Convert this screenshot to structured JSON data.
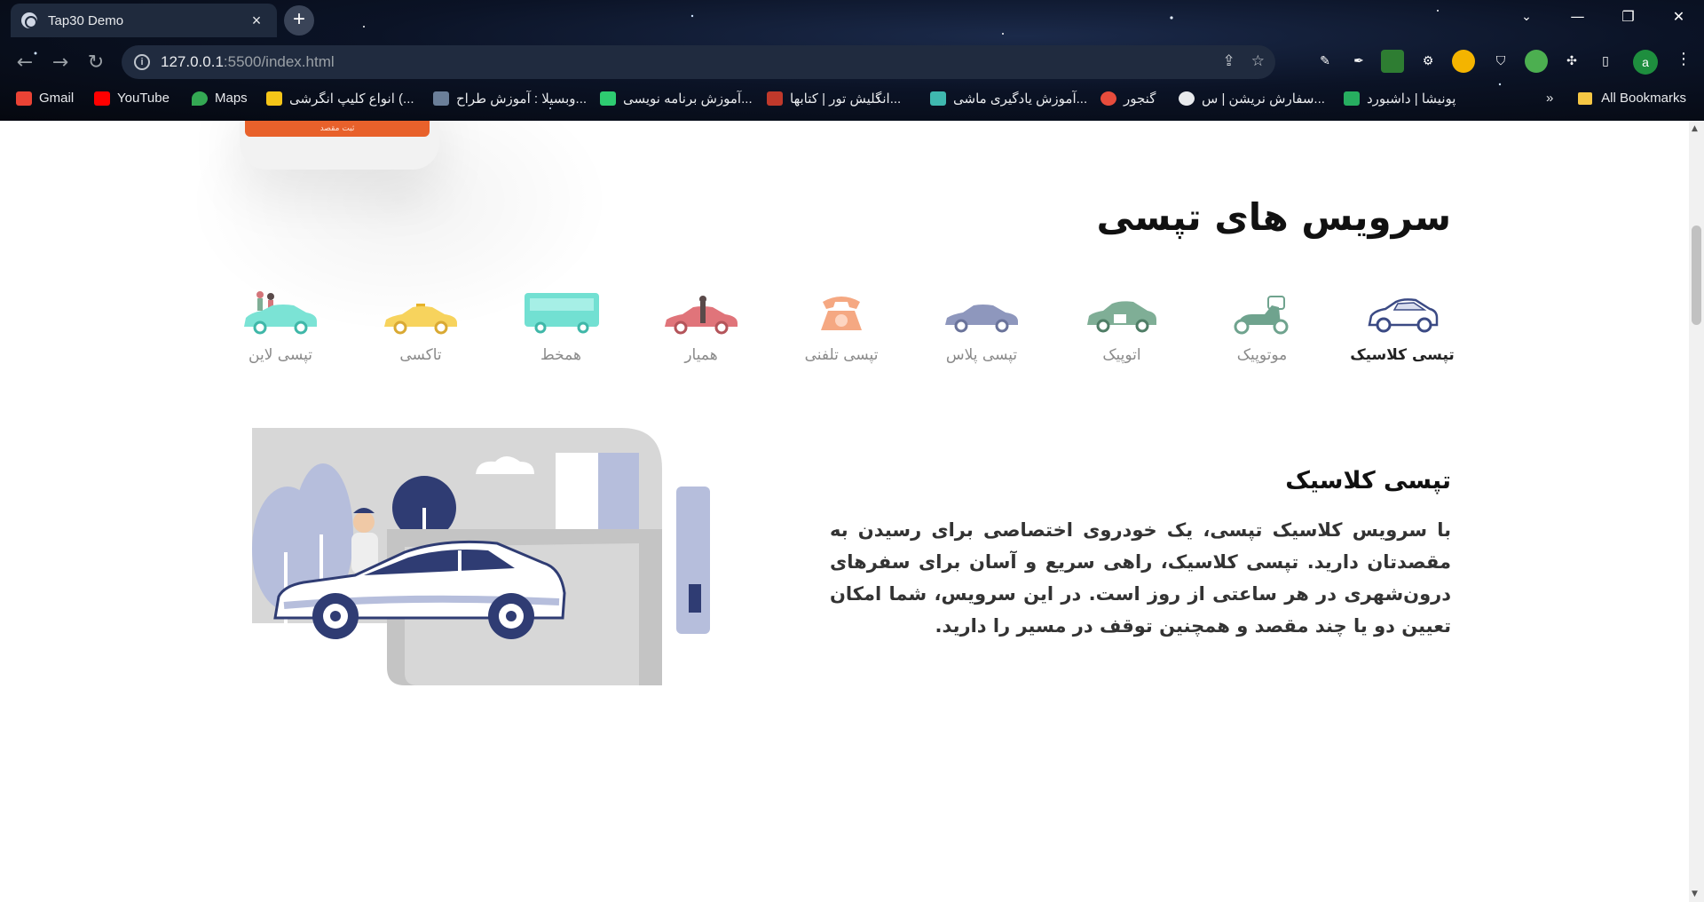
{
  "browser": {
    "tab_title": "Tap30 Demo",
    "tab_close": "×",
    "new_tab": "+",
    "url_host": "127.0.0.1",
    "url_path": ":5500/index.html",
    "profile_initial": "a",
    "bookmarks": [
      {
        "label": "Gmail",
        "color": "#ea4335"
      },
      {
        "label": "YouTube",
        "color": "#ff0000"
      },
      {
        "label": "Maps",
        "color": "#34a853"
      },
      {
        "label": "انواع کلیپ انگرشی (...",
        "color": "#f5c518"
      },
      {
        "label": "وبسیلا : آموزش طراح...",
        "color": "#6b7f99"
      },
      {
        "label": "آموزش برنامه نویسی...",
        "color": "#2ecc71"
      },
      {
        "label": "انگلیش تور | کتابها...",
        "color": "#c0392b"
      },
      {
        "label": "آموزش یادگیری ماشی...",
        "color": "#3fb8af"
      },
      {
        "label": "گنجور",
        "color": "#e74c3c"
      },
      {
        "label": "سفارش نریشن | س...",
        "color": "#e8eaed"
      },
      {
        "label": "پونیشا | داشبورد",
        "color": "#27ae60"
      }
    ],
    "bookmarks_overflow": "»",
    "all_bookmarks": "All Bookmarks"
  },
  "page": {
    "phone_button": "ثبت مقصد",
    "section_title": "سرویس های تپسی",
    "services": [
      {
        "label": "تپسی کلاسیک",
        "active": true,
        "color": "#3b4a84"
      },
      {
        "label": "موتوپیک",
        "active": false,
        "color": "#6fa38e"
      },
      {
        "label": "اتوپیک",
        "active": false,
        "color": "#7fae96"
      },
      {
        "label": "تپسی پلاس",
        "active": false,
        "color": "#8e97bd"
      },
      {
        "label": "تپسی تلفنی",
        "active": false,
        "color": "#f5a882"
      },
      {
        "label": "همیار",
        "active": false,
        "color": "#e0747a"
      },
      {
        "label": "همخط",
        "active": false,
        "color": "#72e0d2"
      },
      {
        "label": "تاکسی",
        "active": false,
        "color": "#f7d35d"
      },
      {
        "label": "تپسی لاین",
        "active": false,
        "color": "#7be3d5"
      }
    ],
    "detail_title": "تپسی کلاسیک",
    "detail_text": "با سرویس کلاسیک تپسی، یک خودروی اختصاصی برای رسیدن به مقصدتان دارید. تپسی کلاسیک، راهی سریع و آسان برای سفرهای درون‌شهری در هر ساعتی از روز است. در این سرویس، شما امکان تعیین دو یا چند مقصد و همچنین توقف در مسیر را دارید."
  }
}
